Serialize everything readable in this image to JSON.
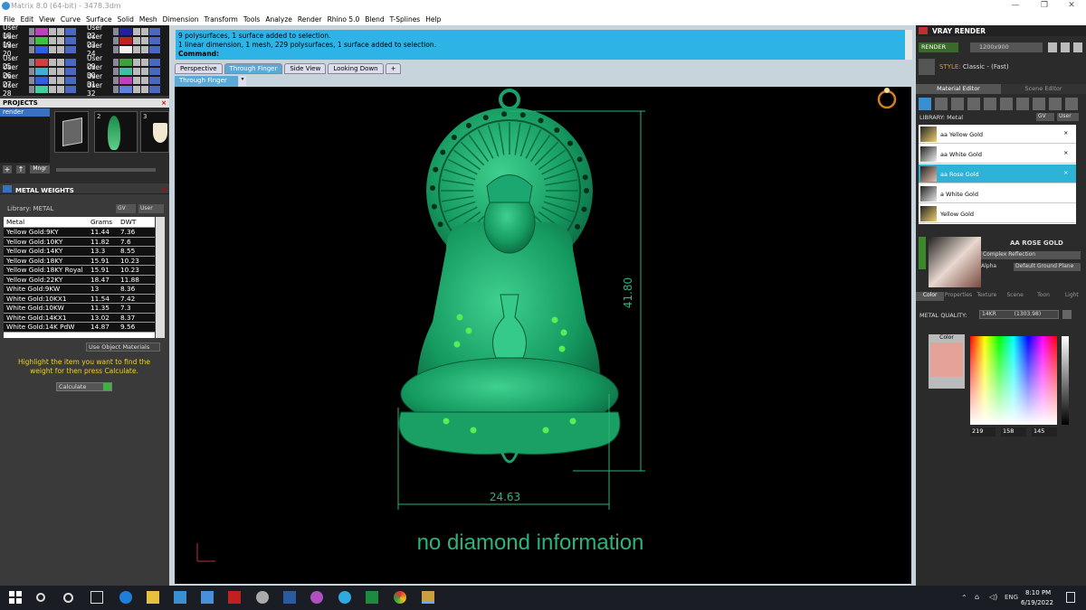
{
  "window": {
    "title": "Matrix 8.0 (64-bit) - 3478.3dm"
  },
  "menu": [
    "File",
    "Edit",
    "View",
    "Curve",
    "Surface",
    "Solid",
    "Mesh",
    "Dimension",
    "Transform",
    "Tools",
    "Analyze",
    "Render",
    "Rhino 5.0",
    "Blend",
    "T-Splines",
    "Help"
  ],
  "layers": {
    "left": [
      "User 18",
      "User 19",
      "User 20",
      "User 25",
      "User 26",
      "User 27",
      "User 28"
    ],
    "right": [
      "User 22",
      "User 23",
      "User 24",
      "User 29",
      "User 30",
      "User 31",
      "User 32"
    ],
    "left_colors": [
      "#c040c0",
      "#40c040",
      "#3060e0",
      "#d04040",
      "#40b0d0",
      "#3060e0",
      "#40d0a0"
    ],
    "right_colors": [
      "#2020a0",
      "#c02020",
      "#f0f0f0",
      "#40a040",
      "#40c0a0",
      "#c040c0",
      "#6080e0"
    ]
  },
  "projects": {
    "title": "PROJECTS",
    "item": "render",
    "thumbs": [
      "2",
      "3"
    ],
    "mngr": "Mngr"
  },
  "metal_weights": {
    "title": "METAL WEIGHTS",
    "library": "Library: METAL",
    "gv": "GV",
    "user": "User",
    "columns": [
      "Metal",
      "Grams",
      "DWT"
    ],
    "rows": [
      [
        "Yellow Gold:9KY",
        "11.44",
        "7.36"
      ],
      [
        "Yellow Gold:10KY",
        "11.82",
        "7.6"
      ],
      [
        "Yellow Gold:14KY",
        "13.3",
        "8.55"
      ],
      [
        "Yellow Gold:18KY",
        "15.91",
        "10.23"
      ],
      [
        "Yellow Gold:18KY Royal",
        "15.91",
        "10.23"
      ],
      [
        "Yellow Gold:22KY",
        "18.47",
        "11.88"
      ],
      [
        "White Gold:9KW",
        "13",
        "8.36"
      ],
      [
        "White Gold:10KX1",
        "11.54",
        "7.42"
      ],
      [
        "White Gold:10KW",
        "11.35",
        "7.3"
      ],
      [
        "White Gold:14KX1",
        "13.02",
        "8.37"
      ],
      [
        "White Gold:14K PdW",
        "14.87",
        "9.56"
      ]
    ],
    "use_object": "Use Object Materials",
    "hint": "Highlight the item you want to find the weight for then press Calculate.",
    "calc": "Calculate"
  },
  "command": {
    "line1": "9 polysurfaces, 1 surface added to selection.",
    "line2": "1 linear dimension, 1 mesh, 229 polysurfaces, 1 surface added to selection.",
    "label": "Command:"
  },
  "viewport": {
    "tabs": [
      "Perspective",
      "Through Finger",
      "Side View",
      "Looking Down"
    ],
    "add": "+",
    "subtab": "Through Finger",
    "dim_h": "41.80",
    "dim_w": "24.63",
    "message": "no diamond information"
  },
  "vray": {
    "title": "VRAY RENDER",
    "render": "RENDER",
    "res": "1200x900",
    "style_label": "STYLE:",
    "style": "Classic - (Fast)",
    "tabs": [
      "Material Editor",
      "Scene Editor"
    ],
    "library": "LIBRARY: Metal",
    "gv": "GV",
    "user": "User",
    "materials": [
      "aa Yellow Gold",
      "aa White Gold",
      "aa Rose Gold",
      "a White Gold",
      "Yellow Gold"
    ],
    "selected": "AA ROSE GOLD",
    "reflection": "Complex Reflection",
    "alpha": "Alpha",
    "ground": "Default Ground Plane",
    "subtabs": [
      "Color",
      "Properties",
      "Texture",
      "Scene",
      "Toon",
      "Light"
    ],
    "metal_quality": "METAL QUALITY:",
    "quality": "14KR",
    "quality_val": "(1303.98)",
    "color_label": "Color",
    "swatch": "#e4a299",
    "r": "219",
    "g": "158",
    "b": "145"
  },
  "taskbar": {
    "time": "8:10 PM",
    "date": "6/19/2022",
    "lang": "ENG"
  }
}
